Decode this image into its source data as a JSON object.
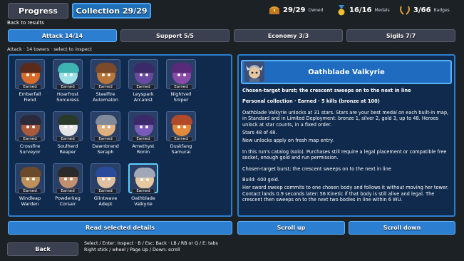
{
  "tabs": {
    "progress": "Progress",
    "collection": "Collection 29/29"
  },
  "stats": [
    {
      "icon": "treasure-chest-icon",
      "value": "29/29",
      "label": "Owned"
    },
    {
      "icon": "medal-icon",
      "value": "16/16",
      "label": "Medals"
    },
    {
      "icon": "laurel-badge-icon",
      "value": "3/66",
      "label": "Badges"
    }
  ],
  "back_to_results": "Back to results",
  "categories": [
    "Attack 14/14",
    "Support 5/5",
    "Economy 3/3",
    "Sigils 7/7"
  ],
  "list_caption": "Attack · 14 towers · select to inspect",
  "earned_label": "Earned",
  "towers": [
    {
      "name": "Emberfall Fiend",
      "earned": true,
      "face": "#d86a2a",
      "hat": "#5a2a1a"
    },
    {
      "name": "Hoarfrost Sorceress",
      "earned": true,
      "face": "#9fe0e6",
      "hat": "#3fb2b2"
    },
    {
      "name": "Steelfire Automaton",
      "earned": true,
      "face": "#b8773a",
      "hat": "#7a4a2a"
    },
    {
      "name": "Leyspark Arcanist",
      "earned": true,
      "face": "#6a4aa0",
      "hat": "#3a2a6a"
    },
    {
      "name": "Nightveil Sniper",
      "earned": true,
      "face": "#8a4aa8",
      "hat": "#5a2a7a"
    },
    {
      "name": "Crossfire Surveyor",
      "earned": true,
      "face": "#a85a3a",
      "hat": "#2a2a3a"
    },
    {
      "name": "Soulherd Reaper",
      "earned": true,
      "face": "#e6e6e6",
      "hat": "#2a3a2a"
    },
    {
      "name": "Dawnbrand Seraph",
      "earned": true,
      "face": "#e0b080",
      "hat": "#808a9a"
    },
    {
      "name": "Amethyst Ronin",
      "earned": true,
      "face": "#7a5ab8",
      "hat": "#3a2a6a"
    },
    {
      "name": "Duskfang Samurai",
      "earned": true,
      "face": "#e08a3a",
      "hat": "#b04a2a"
    },
    {
      "name": "Windleap Warden",
      "earned": true,
      "face": "#c0905a",
      "hat": "#6a4a2a"
    },
    {
      "name": "Powderkeg Corsair",
      "earned": true,
      "face": "#c09070",
      "hat": "#2a2a2a"
    },
    {
      "name": "Glintwave Adept",
      "earned": true,
      "face": "#e0c0a0",
      "hat": "#2a4a9a"
    },
    {
      "name": "Oathblade Valkyrie",
      "earned": true,
      "face": "#e6c8a0",
      "hat": "#a0a8b8",
      "selected": true
    }
  ],
  "detail": {
    "title": "Oathblade Valkyrie",
    "lines": [
      {
        "text": "Chosen-target burst; the crescent sweeps on to the next in line",
        "bold": true,
        "gap": true
      },
      {
        "text": "Personal collection · Earned · 5 kills (bronze at 100)",
        "bold": true,
        "gap": true
      },
      {
        "text": "Oathblade Valkyrie unlocks at 31 stars. Stars are your best medal on each built-in map, in Standard and in Limited Deployment: bronze 1, silver 2, gold 3, up to 48. Heroes unlock at star counts, in a fixed order.",
        "bold": false
      },
      {
        "text": "Stars 48 of 48.",
        "bold": false
      },
      {
        "text": "New unlocks apply on fresh map entry.",
        "bold": false,
        "gap": true
      },
      {
        "text": "In this run's catalog (solo). Purchases still require a legal placement or compatible free socket, enough gold and run permission.",
        "bold": false,
        "gap": true
      },
      {
        "text": "Chosen-target burst; the crescent sweeps on to the next in line",
        "bold": false,
        "gap": true
      },
      {
        "text": "Build: 400 gold.",
        "bold": false
      },
      {
        "text": "Her sword sweep commits to one chosen body and follows it without moving her tower. Contact lands 0.9 seconds later: 56 Kinetic if that body is still alive and legal. The crescent then sweeps on to the next two bodies in line within 6 WU.",
        "bold": false
      }
    ]
  },
  "buttons": {
    "read": "Read selected details",
    "scroll_up": "Scroll up",
    "scroll_down": "Scroll down",
    "back": "Back"
  },
  "hints": [
    "Select / Enter: inspect · B / Esc: Back · LB / RB or Q / E: tabs",
    "Right stick / wheel / Page Up / Down: scroll"
  ],
  "colors": {
    "accent": "#2c7fd0",
    "panel": "#0f2a4d",
    "background": "#1c2126"
  }
}
